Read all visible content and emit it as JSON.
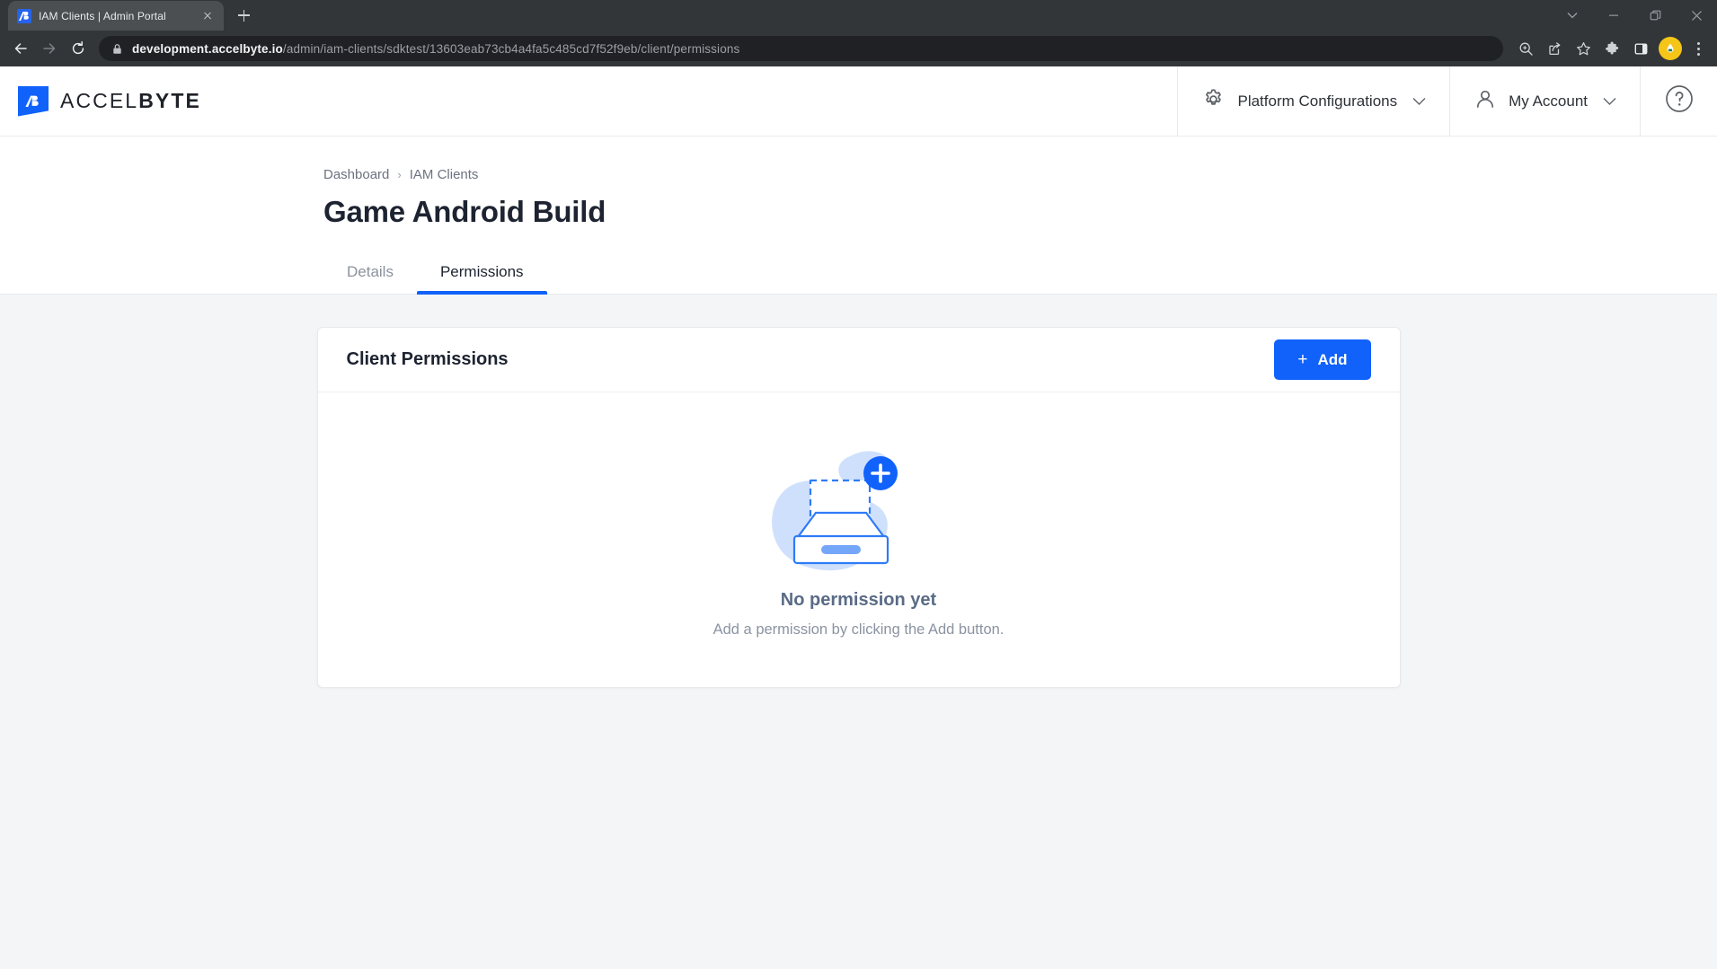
{
  "browser": {
    "tab": {
      "title": "IAM Clients | Admin Portal",
      "favicon_label": "AB"
    },
    "new_tab_label": "+",
    "omnibox": {
      "host": "development.accelbyte.io",
      "path": "/admin/iam-clients/sdktest/13603eab73cb4a4fa5c485cd7f52f9eb/client/permissions",
      "full_url": "development.accelbyte.io/admin/iam-clients/sdktest/13603eab73cb4a4fa5c485cd7f52f9eb/client/permissions"
    },
    "window_controls": [
      "tab-search-icon",
      "minimize-icon",
      "maximize-icon",
      "close-icon"
    ],
    "toolbar_icons": [
      "back-icon",
      "forward-icon",
      "reload-icon",
      "zoom-icon",
      "share-icon",
      "bookmark-star-icon",
      "extensions-puzzle-icon",
      "side-panel-icon",
      "profile-avatar",
      "more-menu-icon"
    ]
  },
  "header": {
    "brand_light": "ACCEL",
    "brand_bold": "BYTE",
    "platform_configurations": "Platform Configurations",
    "my_account": "My Account",
    "help_label": "?"
  },
  "breadcrumb": {
    "items": [
      "Dashboard",
      "IAM Clients"
    ],
    "separator": "›"
  },
  "page": {
    "title": "Game Android Build"
  },
  "tabs": [
    {
      "label": "Details",
      "active": false
    },
    {
      "label": "Permissions",
      "active": true
    }
  ],
  "card": {
    "title": "Client Permissions",
    "add_button": {
      "label": "Add",
      "plus": "+"
    }
  },
  "empty_state": {
    "title": "No permission yet",
    "subtitle": "Add a permission by clicking the Add button.",
    "illustration": "empty-inbox-add-illustration"
  },
  "colors": {
    "accent_blue": "#1062fb",
    "page_bg": "#f4f5f7",
    "card_bg": "#ffffff",
    "text_dark": "#1d2330",
    "text_muted": "#8b93a1",
    "empty_title": "#5a6b86",
    "illo_light": "#cfe0fd",
    "chrome_dark": "#323639"
  }
}
